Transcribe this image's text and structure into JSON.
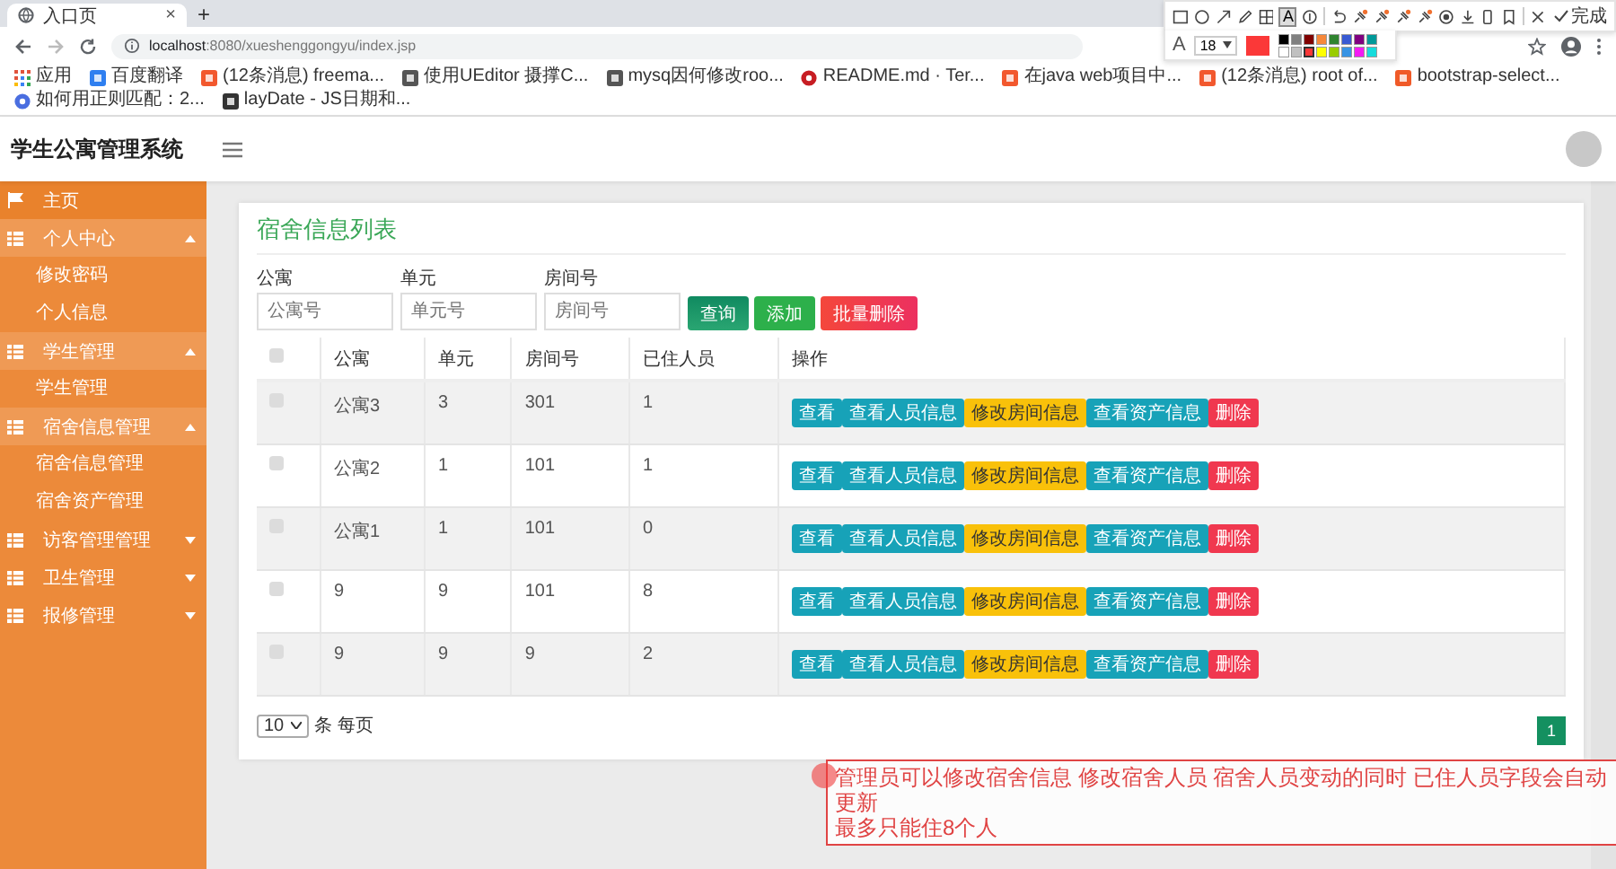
{
  "browser": {
    "tab_title": "入口页",
    "tab_close": "×",
    "new_tab": "+",
    "url_host": "localhost",
    "url_path": ":8080/xueshenggongyu/index.jsp",
    "bookmarks": [
      {
        "label": "应用",
        "kind": "apps"
      },
      {
        "label": "百度翻译",
        "kind": "translate"
      },
      {
        "label": "(12条消息) freema...",
        "kind": "csdn"
      },
      {
        "label": "使用UEditor 摄撑C...",
        "kind": "feather"
      },
      {
        "label": "mysq因何修改roo...",
        "kind": "feather"
      },
      {
        "label": "README.md · Ter...",
        "kind": "gitee"
      },
      {
        "label": "在java web项目中...",
        "kind": "csdn"
      },
      {
        "label": "(12条消息) root of...",
        "kind": "csdn"
      },
      {
        "label": "bootstrap-select...",
        "kind": "doc"
      },
      {
        "label": "如何用正则匹配：2...",
        "kind": "flower"
      },
      {
        "label": "layDate - JS日期和...",
        "kind": "book"
      }
    ]
  },
  "capture_toolbar": {
    "text_tool": "A",
    "font_label": "A",
    "font_size": "18",
    "done": "完成",
    "swatches": [
      {
        "color": "#000000",
        "selected": false
      },
      {
        "color": "#808080",
        "selected": false
      },
      {
        "color": "#800000",
        "selected": false
      },
      {
        "color": "#f7883a",
        "selected": false
      },
      {
        "color": "#308430",
        "selected": false
      },
      {
        "color": "#385ad3",
        "selected": false
      },
      {
        "color": "#800080",
        "selected": false
      },
      {
        "color": "#009999",
        "selected": false
      },
      {
        "color": "#ffffff",
        "selected": false
      },
      {
        "color": "#c0c0c0",
        "selected": false
      },
      {
        "color": "#fb3838",
        "selected": true
      },
      {
        "color": "#ffff00",
        "selected": false
      },
      {
        "color": "#99cc00",
        "selected": false
      },
      {
        "color": "#3894e4",
        "selected": false
      },
      {
        "color": "#f31bf3",
        "selected": false
      },
      {
        "color": "#16dcdc",
        "selected": false
      }
    ]
  },
  "app": {
    "title": "学生公寓管理系统"
  },
  "sidebar": {
    "items": [
      {
        "label": "主页",
        "kind": "home"
      },
      {
        "label": "个人中心",
        "kind": "group",
        "expanded": true,
        "children": [
          {
            "label": "修改密码"
          },
          {
            "label": "个人信息"
          }
        ]
      },
      {
        "label": "学生管理",
        "kind": "group",
        "expanded": true,
        "children": [
          {
            "label": "学生管理"
          }
        ]
      },
      {
        "label": "宿舍信息管理",
        "kind": "group",
        "expanded": true,
        "children": [
          {
            "label": "宿舍信息管理"
          },
          {
            "label": "宿舍资产管理"
          }
        ]
      },
      {
        "label": "访客管理管理",
        "kind": "group",
        "expanded": false
      },
      {
        "label": "卫生管理",
        "kind": "group",
        "expanded": false
      },
      {
        "label": "报修管理",
        "kind": "group",
        "expanded": false
      }
    ]
  },
  "page": {
    "title": "宿舍信息列表",
    "filters": [
      {
        "label": "公寓",
        "placeholder": "公寓号"
      },
      {
        "label": "单元",
        "placeholder": "单元号"
      },
      {
        "label": "房间号",
        "placeholder": "房间号"
      }
    ],
    "buttons": [
      {
        "label": "查询",
        "kind": "search"
      },
      {
        "label": "添加",
        "kind": "add"
      },
      {
        "label": "批量删除",
        "kind": "delete"
      }
    ]
  },
  "table": {
    "columns": [
      "公寓",
      "单元",
      "房间号",
      "已住人员",
      "操作"
    ],
    "header_checked": false,
    "rows": [
      {
        "checked": false,
        "cells": [
          "公寓3",
          "3",
          "301",
          "1"
        ],
        "actions": [
          {
            "label": "查看",
            "kind": "view"
          },
          {
            "label": "查看人员信息",
            "kind": "view"
          },
          {
            "label": "修改房间信息",
            "kind": "edit"
          },
          {
            "label": "查看资产信息",
            "kind": "view"
          },
          {
            "label": "删除",
            "kind": "delete"
          }
        ]
      },
      {
        "checked": false,
        "cells": [
          "公寓2",
          "1",
          "101",
          "1"
        ],
        "actions": [
          {
            "label": "查看",
            "kind": "view"
          },
          {
            "label": "查看人员信息",
            "kind": "view"
          },
          {
            "label": "修改房间信息",
            "kind": "edit"
          },
          {
            "label": "查看资产信息",
            "kind": "view"
          },
          {
            "label": "删除",
            "kind": "delete"
          }
        ]
      },
      {
        "checked": false,
        "cells": [
          "公寓1",
          "1",
          "101",
          "0"
        ],
        "actions": [
          {
            "label": "查看",
            "kind": "view"
          },
          {
            "label": "查看人员信息",
            "kind": "view"
          },
          {
            "label": "修改房间信息",
            "kind": "edit"
          },
          {
            "label": "查看资产信息",
            "kind": "view"
          },
          {
            "label": "删除",
            "kind": "delete"
          }
        ]
      },
      {
        "checked": false,
        "cells": [
          "9",
          "9",
          "101",
          "8"
        ],
        "actions": [
          {
            "label": "查看",
            "kind": "view"
          },
          {
            "label": "查看人员信息",
            "kind": "view"
          },
          {
            "label": "修改房间信息",
            "kind": "edit"
          },
          {
            "label": "查看资产信息",
            "kind": "view"
          },
          {
            "label": "删除",
            "kind": "delete"
          }
        ]
      },
      {
        "checked": false,
        "cells": [
          "9",
          "9",
          "9",
          "2"
        ],
        "actions": [
          {
            "label": "查看",
            "kind": "view"
          },
          {
            "label": "查看人员信息",
            "kind": "view"
          },
          {
            "label": "修改房间信息",
            "kind": "edit"
          },
          {
            "label": "查看资产信息",
            "kind": "view"
          },
          {
            "label": "删除",
            "kind": "delete"
          }
        ]
      }
    ]
  },
  "pagination": {
    "page_size": "10",
    "per_page_label": "条 每页",
    "pages": [
      {
        "label": "1",
        "selected": true
      }
    ]
  },
  "annotation": {
    "lines": [
      "管理员可以修改宿舍信息  修改宿舍人员  宿舍人员变动的同时  已住人员字段会自动更新",
      "最多只能住8个人"
    ]
  }
}
